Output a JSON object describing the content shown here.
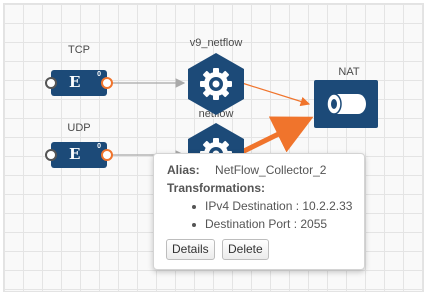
{
  "canvas": {
    "nodes": {
      "tcp": {
        "label": "TCP",
        "count": "0",
        "icon": "logo-e-icon"
      },
      "udp": {
        "label": "UDP",
        "count": "0",
        "icon": "logo-e-icon"
      },
      "v9_netflow": {
        "label": "v9_netflow",
        "icon": "gear-icon"
      },
      "netflow": {
        "label": "netflow",
        "icon": "gear-icon"
      },
      "nat": {
        "label": "NAT",
        "icon": "pipe-icon"
      }
    },
    "colors": {
      "node_blue": "#1c4a78",
      "link_gray": "#a9a9a9",
      "link_orange": "#f0742c",
      "gear_hex": "#1c4a78"
    }
  },
  "tooltip": {
    "alias_label": "Alias:",
    "alias_value": "NetFlow_Collector_2",
    "transformations_label": "Transformations:",
    "transformations": [
      "IPv4 Destination : 10.2.2.33",
      "Destination Port : 2055"
    ],
    "details_button": "Details",
    "delete_button": "Delete"
  }
}
